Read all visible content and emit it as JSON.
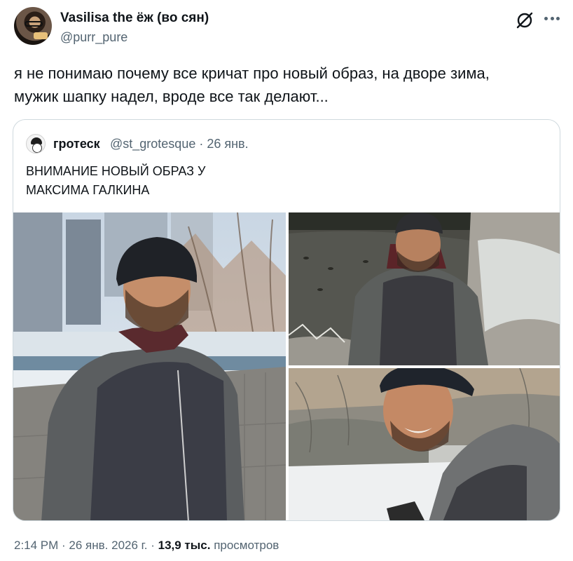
{
  "author": {
    "name": "Vasilisa the ёж (во сян)",
    "handle": "@purr_pure"
  },
  "tweet": {
    "line1": "я не понимаю почему все кричат про новый образ, на дворе зима,",
    "line2": "мужик шапку надел, вроде все так делают..."
  },
  "quoted": {
    "name": "гротеск",
    "handle_date": "@st_grotesque · 26 янв.",
    "line1": "ВНИМАНИЕ НОВЫЙ ОБРАЗ У",
    "line2": "МАКСИМА ГАЛКИНА"
  },
  "footer": {
    "time_date": "2:14 PM · 26 янв. 2026 г. · ",
    "views_count": "13,9 тыс.",
    "views_label": " просмотров"
  },
  "icons": {
    "grok": "grok-icon",
    "more": "more-icon"
  }
}
